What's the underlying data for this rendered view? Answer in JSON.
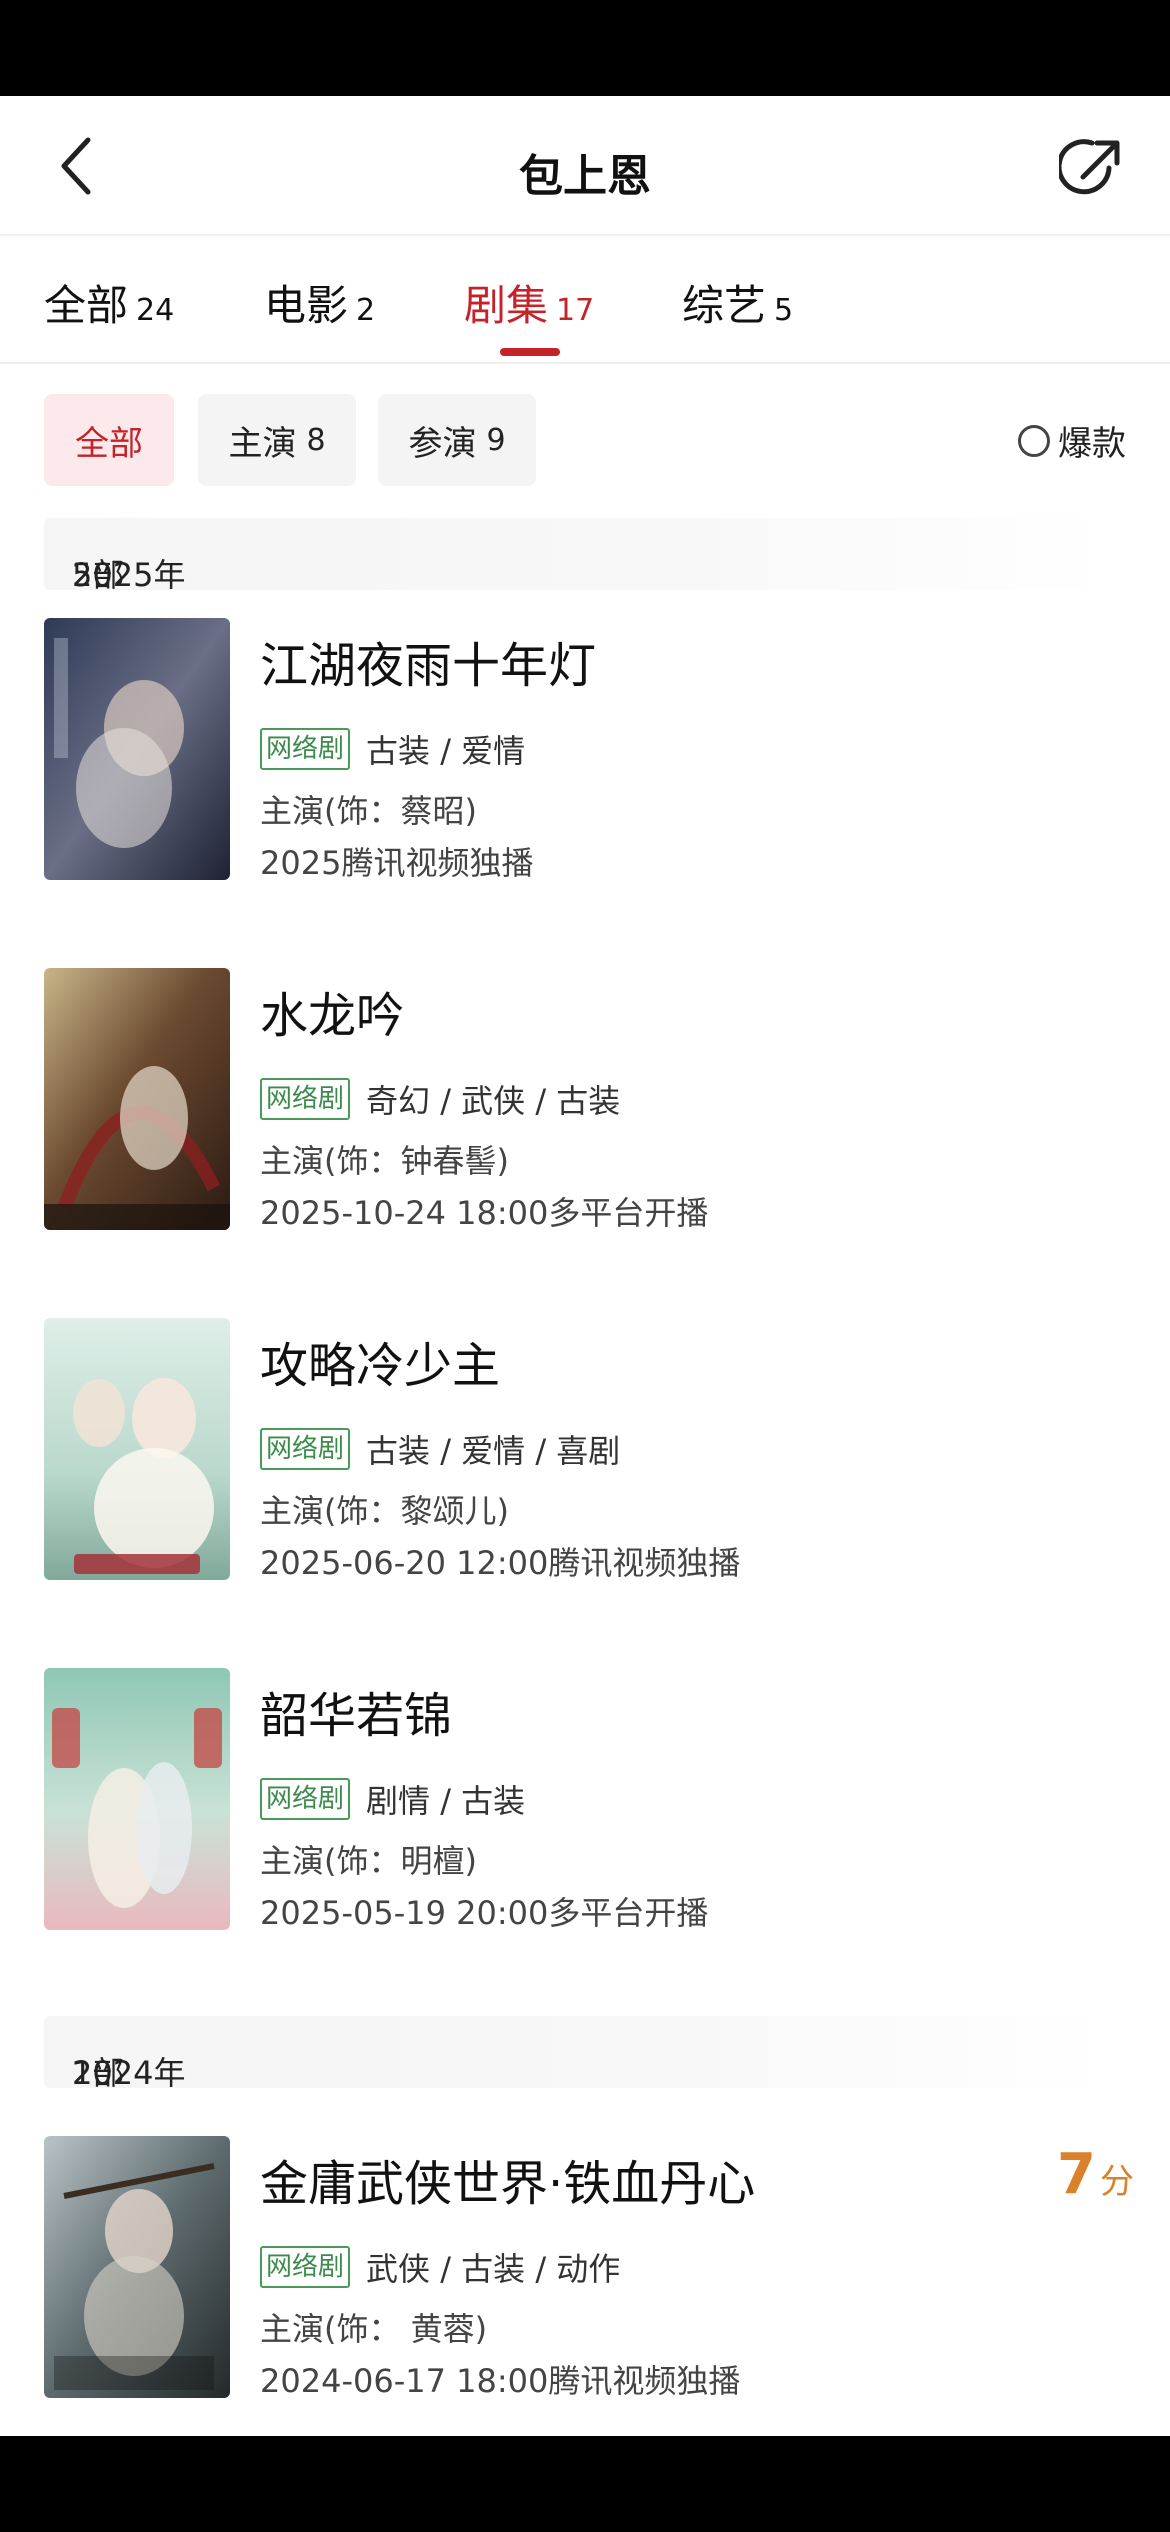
{
  "header": {
    "title": "包上恩",
    "back_icon": "chevron-left-icon",
    "share_icon": "share-icon"
  },
  "tabs": [
    {
      "label": "全部",
      "count": "24",
      "active": false
    },
    {
      "label": "电影",
      "count": "2",
      "active": false
    },
    {
      "label": "剧集",
      "count": "17",
      "active": true
    },
    {
      "label": "综艺",
      "count": "5",
      "active": false
    }
  ],
  "filters": {
    "chips": [
      {
        "label": "全部",
        "count": "",
        "active": true
      },
      {
        "label": "主演",
        "count": "8",
        "active": false
      },
      {
        "label": "参演",
        "count": "9",
        "active": false
      }
    ],
    "hot_label": "爆款",
    "hot_checked": false
  },
  "sections": [
    {
      "year": "2025年",
      "count": "5部"
    },
    {
      "year": "2024年",
      "count": "1部"
    }
  ],
  "items": [
    {
      "title": "江湖夜雨十年灯",
      "tag": "网络剧",
      "genres": "古装 / 爱情",
      "role": "主演(饰：蔡昭)",
      "release": "2025腾讯视频独播",
      "score": ""
    },
    {
      "title": "水龙吟",
      "tag": "网络剧",
      "genres": "奇幻 / 武侠 / 古装",
      "role": "主演(饰：钟春髻)",
      "release": "2025-10-24 18:00多平台开播",
      "score": ""
    },
    {
      "title": "攻略冷少主",
      "tag": "网络剧",
      "genres": "古装 / 爱情 / 喜剧",
      "role": "主演(饰：黎颂儿)",
      "release": "2025-06-20 12:00腾讯视频独播",
      "score": ""
    },
    {
      "title": "韶华若锦",
      "tag": "网络剧",
      "genres": "剧情 / 古装",
      "role": "主演(饰：明檀)",
      "release": "2025-05-19 20:00多平台开播",
      "score": ""
    },
    {
      "title": "金庸武侠世界·铁血丹心",
      "tag": "网络剧",
      "genres": "武侠 / 古装 / 动作",
      "role": "主演(饰： 黄蓉)",
      "release": "2024-06-17 18:00腾讯视频独播",
      "score": "7",
      "score_unit": "分"
    }
  ],
  "colors": {
    "accent": "#c4232a",
    "tag_green": "#3d8a4d",
    "score_orange": "#d9822b"
  }
}
